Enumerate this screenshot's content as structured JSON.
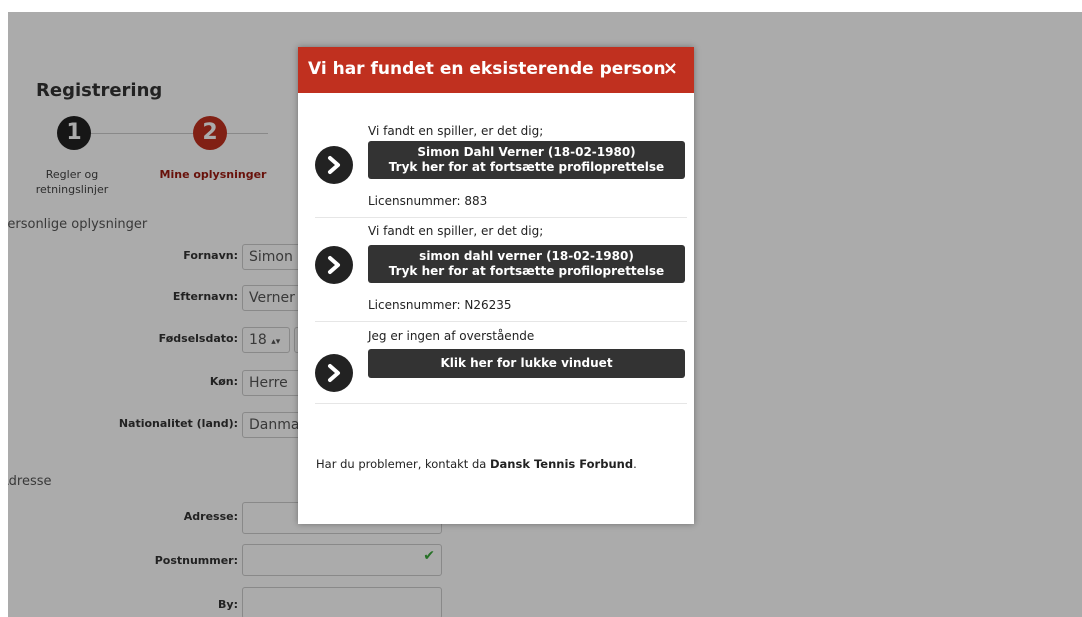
{
  "page": {
    "title": "Registrering",
    "steps": [
      {
        "number": "1",
        "label": "Regler og retningslinjer"
      },
      {
        "number": "2",
        "label": "Mine oplysninger"
      }
    ],
    "personal_section": "Personlige oplysninger",
    "fields": {
      "fornavn": {
        "label": "Fornavn:",
        "value": "Simon"
      },
      "efternavn": {
        "label": "Efternavn:",
        "value": "Verner"
      },
      "fodselsdato": {
        "label": "Fødselsdato:",
        "value": "18"
      },
      "kon": {
        "label": "Køn:",
        "value": "Herre"
      },
      "nationalitet": {
        "label": "Nationalitet (land):",
        "value": "Danmark"
      }
    },
    "address_section": "Adresse",
    "address_fields": {
      "adresse": {
        "label": "Adresse:",
        "value": ""
      },
      "postnummer": {
        "label": "Postnummer:",
        "value": ""
      },
      "by": {
        "label": "By:",
        "value": ""
      }
    }
  },
  "dialog": {
    "title": "Vi har fundet en eksisterende person",
    "close": "×",
    "options": [
      {
        "intro": "Vi fandt en spiller, er det dig;",
        "button_line1": "Simon Dahl Verner (18-02-1980)",
        "button_line2": "Tryk her for at fortsætte profiloprettelse",
        "license": "Licensnummer: 883"
      },
      {
        "intro": "Vi fandt en spiller, er det dig;",
        "button_line1": "simon dahl verner (18-02-1980)",
        "button_line2": "Tryk her for at fortsætte profiloprettelse",
        "license": "Licensnummer: N26235"
      },
      {
        "intro": "Jeg er ingen af overstående",
        "button_line1": "Klik her for lukke vinduet"
      }
    ],
    "footer_prefix": "Har du problemer, kontakt da ",
    "footer_org": "Dansk Tennis Forbund",
    "footer_suffix": "."
  },
  "colors": {
    "accent": "#c0301f",
    "button": "#333333",
    "overlay": "rgba(0,0,0,0.33)"
  }
}
